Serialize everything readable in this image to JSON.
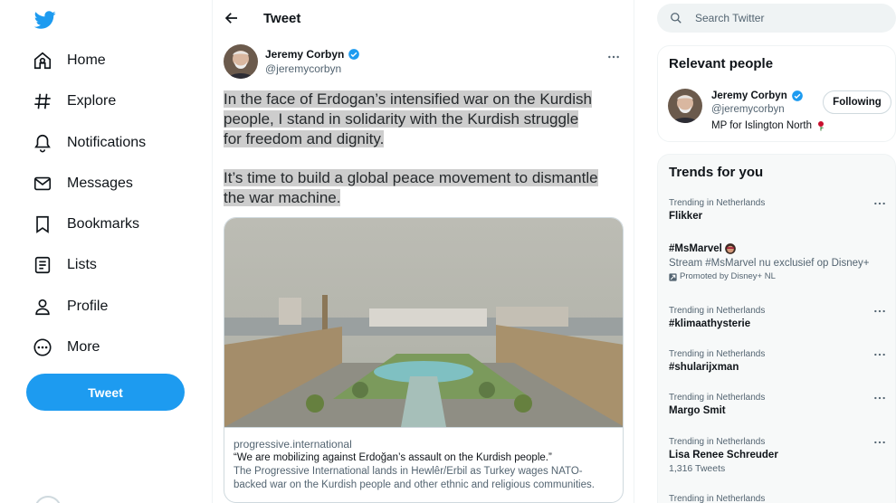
{
  "nav": {
    "items": [
      {
        "label": "Home",
        "icon": "home-icon"
      },
      {
        "label": "Explore",
        "icon": "hashtag-icon"
      },
      {
        "label": "Notifications",
        "icon": "bell-icon"
      },
      {
        "label": "Messages",
        "icon": "envelope-icon"
      },
      {
        "label": "Bookmarks",
        "icon": "bookmark-icon"
      },
      {
        "label": "Lists",
        "icon": "list-icon"
      },
      {
        "label": "Profile",
        "icon": "person-icon"
      },
      {
        "label": "More",
        "icon": "more-circle-icon"
      }
    ],
    "tweet_button": "Tweet"
  },
  "main": {
    "header_title": "Tweet",
    "tweet": {
      "author_name": "Jeremy Corbyn",
      "author_handle": "@jeremycorbyn",
      "paragraphs": [
        [
          "In the face of Erdogan’s intensified war on the Kurdish",
          "people, I stand in solidarity with the Kurdish struggle",
          "for freedom and dignity."
        ],
        [
          "It’s time to build a global peace movement to dismantle",
          "the war machine."
        ]
      ],
      "card": {
        "domain": "progressive.international",
        "title": "“We are mobilizing against Erdoğan’s assault on the Kurdish people.”",
        "description_lines": [
          "The Progressive International lands in Hewlêr/Erbil as Turkey wages NATO-",
          "backed war on the Kurdish people and other ethnic and religious communities."
        ]
      }
    }
  },
  "search": {
    "placeholder": "Search Twitter"
  },
  "relevant_people": {
    "title": "Relevant people",
    "person": {
      "name": "Jeremy Corbyn",
      "handle": "@jeremycorbyn",
      "bio": "MP for Islington North",
      "button": "Following"
    }
  },
  "trends": {
    "title": "Trends for you",
    "items": [
      {
        "context": "Trending in Netherlands",
        "name": "Flikker"
      },
      {
        "name": "#MsMarvel",
        "promo": "Stream #MsMarvel nu exclusief op Disney+",
        "promoted_by": "Promoted by Disney+ NL"
      },
      {
        "context": "Trending in Netherlands",
        "name": "#klimaathysterie"
      },
      {
        "context": "Trending in Netherlands",
        "name": "#shularijxman"
      },
      {
        "context": "Trending in Netherlands",
        "name": "Margo Smit"
      },
      {
        "context": "Trending in Netherlands",
        "name": "Lisa Renee Schreuder",
        "meta": "1,316 Tweets"
      },
      {
        "context": "Trending in Netherlands"
      }
    ]
  },
  "colors": {
    "accent": "#1d9bf0",
    "text": "#0f1419",
    "secondary": "#536471",
    "highlight": "#cdcdcd"
  }
}
